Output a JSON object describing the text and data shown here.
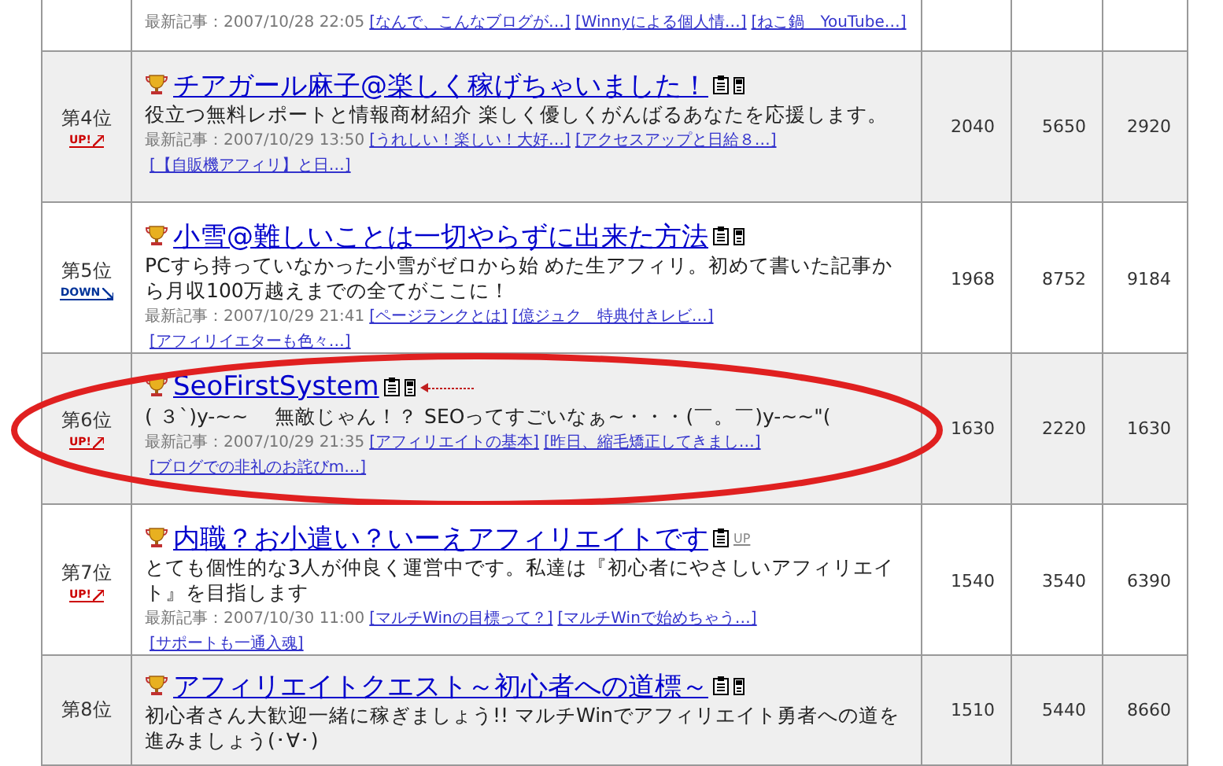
{
  "partial_row": {
    "latest_label": "最新記事：",
    "date": "2007/10/28 22:05",
    "links": [
      "[なんで、こんなブログが…]",
      "[Winnyによる個人情…]",
      "[ねこ鍋　YouTube…]"
    ]
  },
  "rows": [
    {
      "rank": "第4位",
      "trend": {
        "kind": "up",
        "label": "UP!"
      },
      "title": "チアガール麻子@楽しく稼げちゃいました！",
      "mobile": true,
      "pointer_arrow": false,
      "update_mark": "",
      "circled": false,
      "description": "役立つ無料レポートと情報商材紹介 楽しく優しくがんばるあなたを応援します。",
      "latest_label": "最新記事：",
      "date": "2007/10/29 13:50",
      "links": [
        "[うれしい！楽しい！大好…]",
        "[アクセスアップと日給８…]",
        "[【自販機アフィリ】と日…]"
      ],
      "values": [
        "2040",
        "5650",
        "2920"
      ]
    },
    {
      "rank": "第5位",
      "trend": {
        "kind": "down",
        "label": "DOWN"
      },
      "title": "小雪@難しいことは一切やらずに出来た方法",
      "mobile": true,
      "pointer_arrow": false,
      "update_mark": "",
      "circled": false,
      "description": "PCすら持っていなかった小雪がゼロから始 めた生アフィリ。初めて書いた記事から月収100万越えまでの全てがここに！",
      "latest_label": "最新記事：",
      "date": "2007/10/29 21:41",
      "links": [
        "[ページランクとは]",
        "[億ジュク　特典付きレビ…]",
        "[アフィリイエターも色々…]"
      ],
      "values": [
        "1968",
        "8752",
        "9184"
      ]
    },
    {
      "rank": "第6位",
      "trend": {
        "kind": "up",
        "label": "UP!"
      },
      "title": "SeoFirstSystem",
      "mobile": true,
      "pointer_arrow": true,
      "update_mark": "",
      "circled": true,
      "description": "( ３`)y-~~　 無敵じゃん！？ SEOってすごいなぁ~・・・(￣。￣)y-~~\"(",
      "latest_label": "最新記事：",
      "date": "2007/10/29 21:35",
      "links": [
        "[アフィリエイトの基本]",
        "[昨日、縮毛矯正してきまし…]",
        "[ブログでの非礼のお詫びm…]"
      ],
      "values": [
        "1630",
        "2220",
        "1630"
      ]
    },
    {
      "rank": "第7位",
      "trend": {
        "kind": "up",
        "label": "UP!"
      },
      "title": "内職？お小遣い？いーえアフィリエイトです",
      "mobile": false,
      "pointer_arrow": false,
      "update_mark": "UP",
      "circled": false,
      "description": "とても個性的な3人が仲良く運営中です。私達は『初心者にやさしいアフィリエイト』を目指します",
      "latest_label": "最新記事：",
      "date": "2007/10/30 11:00",
      "links": [
        "[マルチWinの目標って？]",
        "[マルチWinで始めちゃう…]",
        "[サポートも一通入魂]"
      ],
      "values": [
        "1540",
        "3540",
        "6390"
      ]
    },
    {
      "rank": "第8位",
      "title": "アフィリエイトクエスト～初心者への道標～",
      "mobile": true,
      "pointer_arrow": false,
      "update_mark": "",
      "circled": false,
      "description": "初心者さん大歓迎一緒に稼ぎましょう!! マルチWinでアフィリエイト勇者への道を進みましょう(･∀･)",
      "values": [
        "1510",
        "5440",
        "8660"
      ]
    }
  ]
}
